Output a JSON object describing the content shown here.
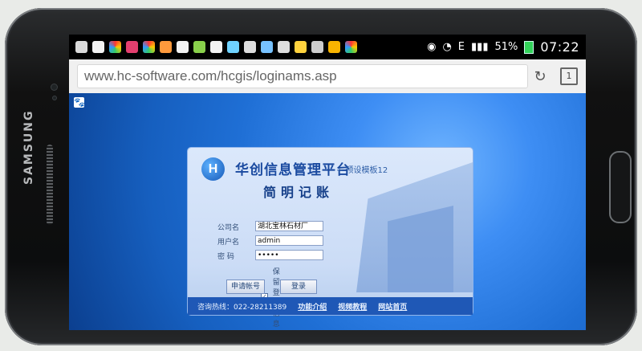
{
  "device": {
    "brand": "SAMSUNG",
    "status": {
      "time": "07:22",
      "battery": "51%",
      "network": "E",
      "icons": [
        "plus-box-icon",
        "shield-icon",
        "aperture-icon",
        "berry-icon",
        "aperture-icon",
        "paw-icon",
        "shield-icon",
        "leaf-icon",
        "shield-icon",
        "headset-icon",
        "wifi-icon",
        "flower-icon",
        "grid-icon",
        "lock-icon",
        "download-icon",
        "leaf-icon",
        "aperture-icon",
        "eye-icon",
        "wifi-icon"
      ]
    }
  },
  "browser": {
    "url": "www.hc-software.com/hcgis/loginams.asp",
    "tab_count": "1"
  },
  "page": {
    "paw_icon": "paw-icon",
    "login": {
      "logo_text": "H",
      "title": "华创信息管理平台",
      "template_label": "+ 预设模板12",
      "subtitle": "简明记账",
      "company_label": "公司名",
      "company_value": "湖北宝林石材厂",
      "username_label": "用户名",
      "username_value": "admin",
      "password_label": "密  码",
      "password_value": "•••••",
      "remember_label": "保留登录信息",
      "remember_checked": "✓",
      "apply_button": "申请帐号",
      "login_button": "登录"
    },
    "footer": {
      "hotline": "咨询热线：022-28211389",
      "features_link": "功能介绍",
      "video_link": "视频教程",
      "home_link": "网站首页"
    }
  }
}
